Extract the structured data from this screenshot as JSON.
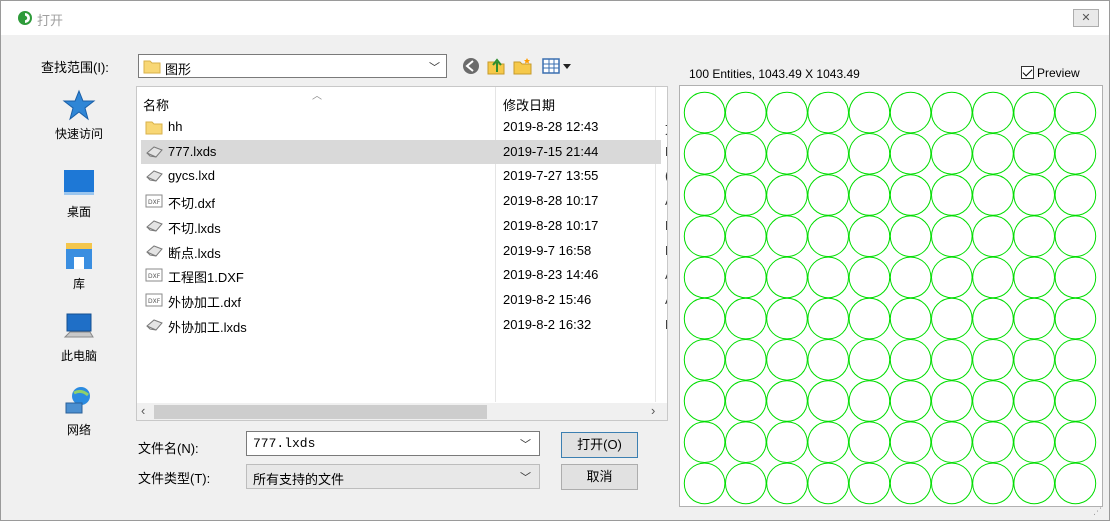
{
  "window": {
    "title": "打开"
  },
  "lookin": {
    "label": "查找范围(I):",
    "value": "图形"
  },
  "places": [
    {
      "label": "快速访问",
      "icon": "star-icon"
    },
    {
      "label": "桌面",
      "icon": "desktop-icon"
    },
    {
      "label": "库",
      "icon": "library-icon"
    },
    {
      "label": "此电脑",
      "icon": "computer-icon"
    },
    {
      "label": "网络",
      "icon": "network-icon"
    }
  ],
  "filelist": {
    "headers": {
      "name": "名称",
      "date": "修改日期"
    },
    "rows": [
      {
        "name": "hh",
        "date": "2019-8-28 12:43",
        "icon": "folder-icon",
        "extra": "文"
      },
      {
        "name": "777.lxds",
        "date": "2019-7-15 21:44",
        "icon": "lxds-file-icon",
        "extra": "L",
        "selected": true
      },
      {
        "name": "gycs.lxd",
        "date": "2019-7-27 13:55",
        "icon": "lxds-file-icon",
        "extra": "("
      },
      {
        "name": "不切.dxf",
        "date": "2019-8-28 10:17",
        "icon": "dxf-file-icon",
        "extra": "A"
      },
      {
        "name": "不切.lxds",
        "date": "2019-8-28 10:17",
        "icon": "lxds-file-icon",
        "extra": "L"
      },
      {
        "name": "断点.lxds",
        "date": "2019-9-7 16:58",
        "icon": "lxds-file-icon",
        "extra": "L"
      },
      {
        "name": "工程图1.DXF",
        "date": "2019-8-23 14:46",
        "icon": "dxf-file-icon",
        "extra": "A"
      },
      {
        "name": "外协加工.dxf",
        "date": "2019-8-2 15:46",
        "icon": "dxf-file-icon",
        "extra": "A"
      },
      {
        "name": "外协加工.lxds",
        "date": "2019-8-2 16:32",
        "icon": "lxds-file-icon",
        "extra": "L"
      }
    ]
  },
  "filename": {
    "label": "文件名(N):",
    "value": "777.lxds"
  },
  "filetype": {
    "label": "文件类型(T):",
    "value": "所有支持的文件"
  },
  "buttons": {
    "open": "打开(O)",
    "cancel": "取消"
  },
  "preview": {
    "info": "100 Entities, 1043.49 X 1043.49",
    "checkbox_label": "Preview",
    "checked": true,
    "grid_rows": 10,
    "grid_cols": 10,
    "stroke_color": "#00dd00"
  }
}
